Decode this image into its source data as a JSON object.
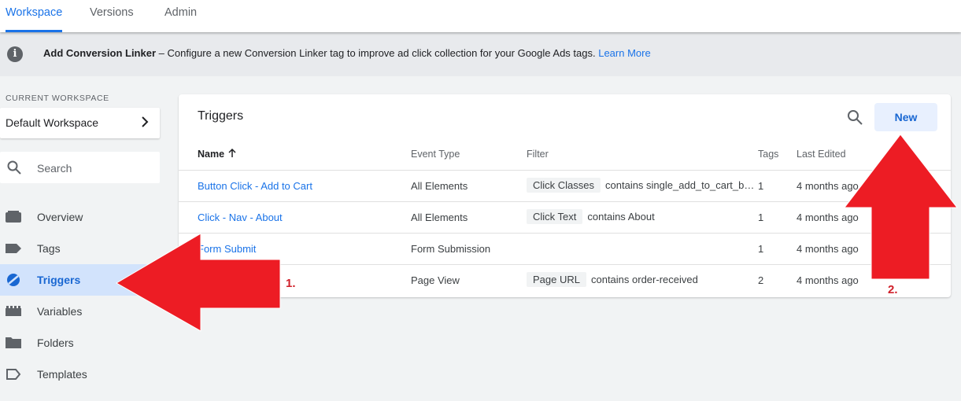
{
  "topnav": {
    "tabs": [
      {
        "label": "Workspace",
        "active": true
      },
      {
        "label": "Versions",
        "active": false
      },
      {
        "label": "Admin",
        "active": false
      }
    ]
  },
  "banner": {
    "icon": "info-icon",
    "title": "Add Conversion Linker",
    "message": " – Configure a new Conversion Linker tag to improve ad click collection for your Google Ads tags. ",
    "link": "Learn More"
  },
  "sidebar": {
    "workspace_label": "CURRENT WORKSPACE",
    "workspace_name": "Default Workspace",
    "search_placeholder": "Search",
    "items": [
      {
        "label": "Overview",
        "icon": "overview-icon",
        "active": false
      },
      {
        "label": "Tags",
        "icon": "tag-icon",
        "active": false
      },
      {
        "label": "Triggers",
        "icon": "trigger-icon",
        "active": true
      },
      {
        "label": "Variables",
        "icon": "variables-icon",
        "active": false
      },
      {
        "label": "Folders",
        "icon": "folder-icon",
        "active": false
      },
      {
        "label": "Templates",
        "icon": "template-icon",
        "active": false
      }
    ]
  },
  "triggers": {
    "title": "Triggers",
    "new_label": "New",
    "columns": {
      "name": "Name",
      "event_type": "Event Type",
      "filter": "Filter",
      "tags": "Tags",
      "last_edited": "Last Edited"
    },
    "rows": [
      {
        "name": "Button Click - Add to Cart",
        "event_type": "All Elements",
        "filter_chip": "Click Classes",
        "filter_text": "contains single_add_to_cart_b…",
        "tags": "1",
        "last_edited": "4 months ago"
      },
      {
        "name": "Click - Nav - About",
        "event_type": "All Elements",
        "filter_chip": "Click Text",
        "filter_text": "contains About",
        "tags": "1",
        "last_edited": "4 months ago"
      },
      {
        "name": "Form Submit",
        "event_type": "Form Submission",
        "filter_chip": "",
        "filter_text": "",
        "tags": "1",
        "last_edited": "4 months ago"
      },
      {
        "name": "",
        "event_type": "Page View",
        "filter_chip": "Page URL",
        "filter_text": "contains order-received",
        "tags": "2",
        "last_edited": "4 months ago"
      }
    ]
  },
  "annotations": {
    "arrow_color": "#ed1c24",
    "label_1": "1.",
    "label_2": "2."
  }
}
